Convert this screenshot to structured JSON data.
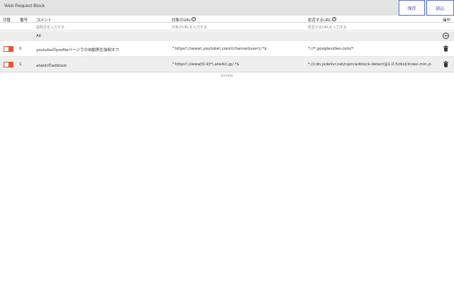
{
  "app": {
    "title": "Web Request Block"
  },
  "toolbar": {
    "save_label": "保存",
    "load_label": "読込"
  },
  "columns": {
    "toggle": "切替",
    "number": "番号",
    "comment": "コメント",
    "target_url": "対象のURL",
    "block_url": "拒否するURL",
    "action": "操作"
  },
  "filters": {
    "comment_placeholder": "説明文を入力する",
    "target_placeholder": "対象のURLを入力する",
    "block_placeholder": "拒否するURLを入力する"
  },
  "all_row": {
    "comment": "All"
  },
  "rows": [
    {
      "number": "0",
      "comment": "youtubeのprofileページでの自動再生強制オフ",
      "target_url": "^https?://www\\.youtube\\.com/(channel|user)/.*$",
      "block_url": "*://*.googlevideo.com/*",
      "enabled": true
    },
    {
      "number": "1",
      "comment": "atwikiのadblock",
      "target_url": "^https?://www[0-9]*\\.atwiki\\.jp/.*$",
      "block_url": "*://cdn.jsdelivr.net/npm/adblock-detect@1.0.5/dist/index.min.js",
      "enabled": true
    }
  ],
  "footer": {
    "donate": "donate"
  },
  "colors": {
    "accent": "#e45534",
    "button_border": "#5b73c9",
    "topbar": "#e3e3e3"
  },
  "icons": {
    "add": "plus-circle-icon",
    "delete": "trash-icon",
    "help": "help-circle-icon"
  }
}
